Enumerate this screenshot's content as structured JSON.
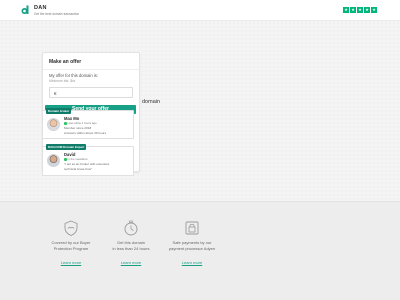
{
  "header": {
    "brand_name": "DAN",
    "tagline": "Get the best domain transaction",
    "rating_stars": 5,
    "brand_color": "#16a085"
  },
  "offer": {
    "title": "Make an offer",
    "label": "My offer for this domain is:",
    "placeholder": "Minimum bid: $xx",
    "currency_symbol": "€",
    "submit_label": "Send your offer"
  },
  "domain_text": "domain",
  "brokers": [
    {
      "role": "Domain broker",
      "name": "Max Mo",
      "status": "Last online 1 hours ago",
      "line1": "Member since 2018",
      "line2": "Answers within about 30 hours"
    },
    {
      "role": "DAN.COM Domain Expert",
      "name": "David",
      "status": "In the meantime",
      "line1": "\"I act as an broker with extensive",
      "line2": "technical know-how\""
    }
  ],
  "features": [
    {
      "icon": "shield-icon",
      "line1": "Covered by our Buyer",
      "line2": "Protection Program",
      "link": "Learn more"
    },
    {
      "icon": "stopwatch-icon",
      "line1": "Get this domain",
      "line2": "in less than 24 hours",
      "link": "Learn more"
    },
    {
      "icon": "secure-payment-icon",
      "line1": "Safe payments by our",
      "line2": "payment processor Adyen",
      "link": "Learn more"
    }
  ]
}
